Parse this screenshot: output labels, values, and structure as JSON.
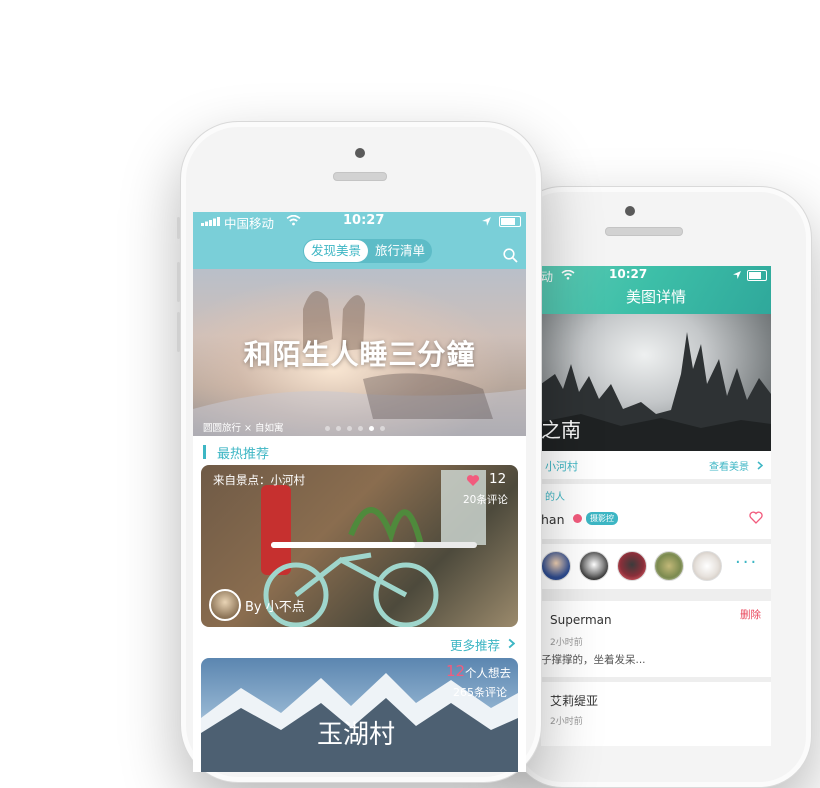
{
  "front": {
    "status": {
      "carrier": "中国移动",
      "time": "10:27"
    },
    "tabs": [
      {
        "label": "发现美景",
        "active": true
      },
      {
        "label": "旅行清单",
        "active": false
      }
    ],
    "banner": {
      "title": "和陌生人睡三分鐘",
      "credit": "圆圆旅行 × 自如寓",
      "page_count": 6,
      "active_page": 5
    },
    "section_title": "最热推荐",
    "card1": {
      "source": "来自景点：小河村",
      "likes": "12",
      "comments": "20条评论",
      "author": "By 小不点",
      "progress": 0.7
    },
    "more_label": "更多推荐",
    "card2": {
      "want_count": "12",
      "want_label": "个人想去",
      "comments": "265条评论",
      "title": "玉湖村"
    },
    "colors": {
      "accent": "#3db6c4",
      "header": "#7acfd8",
      "like": "#f25b7d"
    }
  },
  "back": {
    "status": {
      "time": "10:27"
    },
    "title": "美图详情",
    "photo_caption": "之南",
    "location": "小河村",
    "view_label": "查看美景",
    "liked_header": "的人",
    "liker": {
      "name": "han",
      "badge": "摄影控"
    },
    "avatars": [
      "superman-avatar",
      "skull-avatar",
      "helmet-avatar",
      "yoda-avatar",
      "beard-avatar"
    ],
    "comments": [
      {
        "name": "Superman",
        "time": "2小时前",
        "text": "子撑撑的，坐着发呆...",
        "action": "删除"
      },
      {
        "name": "艾莉缇亚",
        "time": "2小时前"
      }
    ],
    "colors": {
      "header": "#3dbfa8",
      "delete": "#e9465b"
    }
  }
}
